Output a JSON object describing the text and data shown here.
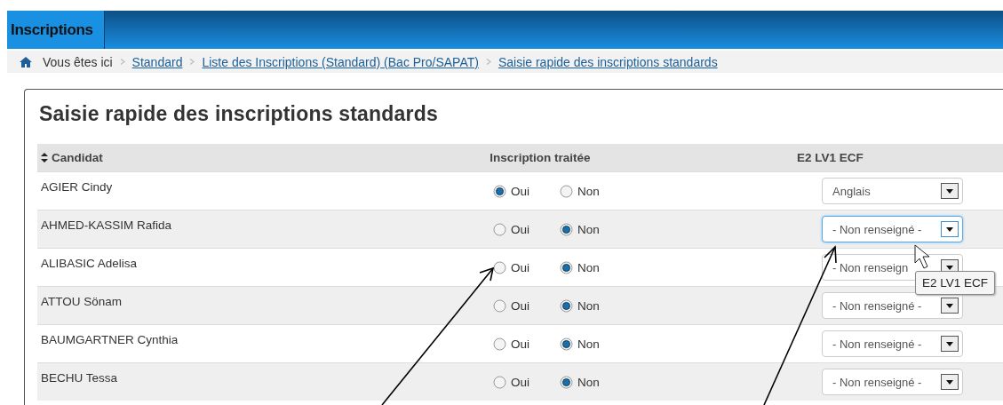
{
  "header": {
    "tabs": [
      {
        "label": "Inscriptions",
        "selected": true
      }
    ]
  },
  "breadcrumb": {
    "label": "Vous êtes ici",
    "links": [
      "Standard",
      "Liste des Inscriptions (Standard) (Bac Pro/SAPAT)",
      "Saisie rapide des inscriptions standards"
    ]
  },
  "title": "Saisie rapide des inscriptions standards",
  "table": {
    "columns": [
      "Candidat",
      "Inscription traitée",
      "E2 LV1 ECF"
    ],
    "rows": [
      {
        "candidat": "AGIER Cindy",
        "options": [
          {
            "label": "Oui",
            "selected": true
          },
          {
            "label": "Non",
            "selected": false
          }
        ],
        "lv1": "Anglais",
        "focused": false
      },
      {
        "candidat": "AHMED-KASSIM Rafida",
        "options": [
          {
            "label": "Oui",
            "selected": false
          },
          {
            "label": "Non",
            "selected": true
          }
        ],
        "lv1": "- Non renseigné -",
        "focused": true
      },
      {
        "candidat": "ALIBASIC Adelisa",
        "options": [
          {
            "label": "Oui",
            "selected": false
          },
          {
            "label": "Non",
            "selected": true
          }
        ],
        "lv1": "- Non renseign",
        "focused": false
      },
      {
        "candidat": "ATTOU Sönam",
        "options": [
          {
            "label": "Oui",
            "selected": false
          },
          {
            "label": "Non",
            "selected": true
          }
        ],
        "lv1": "- Non renseigné -",
        "focused": false
      },
      {
        "candidat": "BAUMGARTNER Cynthia",
        "options": [
          {
            "label": "Oui",
            "selected": false
          },
          {
            "label": "Non",
            "selected": true
          }
        ],
        "lv1": "- Non renseigné -",
        "focused": false
      },
      {
        "candidat": "BECHU Tessa",
        "options": [
          {
            "label": "Oui",
            "selected": false
          },
          {
            "label": "Non",
            "selected": true
          }
        ],
        "lv1": "- Non renseigné -",
        "focused": false
      }
    ]
  },
  "tooltip": "E2 LV1 ECF"
}
